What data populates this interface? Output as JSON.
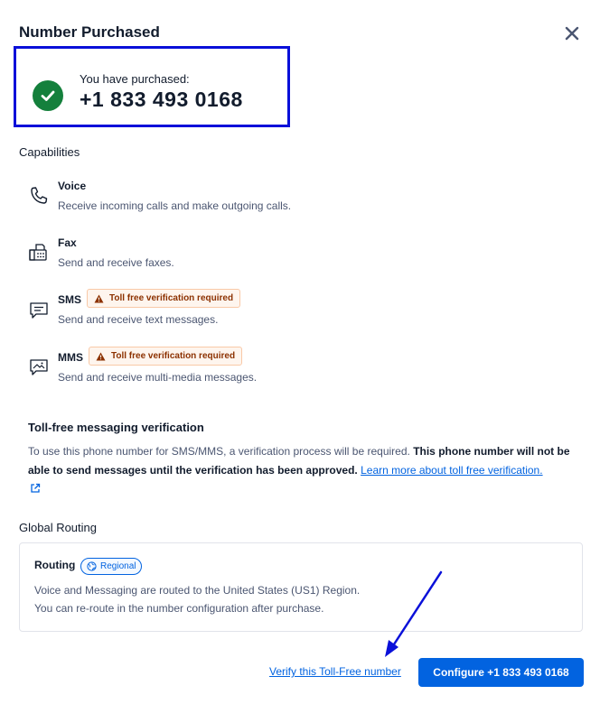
{
  "modal": {
    "title": "Number Purchased",
    "close_icon": "close-icon"
  },
  "purchase": {
    "label": "You have purchased:",
    "number": "+1 833 493 0168",
    "status_icon": "check-circle-icon",
    "status_color": "#14803c"
  },
  "capabilities": {
    "title": "Capabilities",
    "items": [
      {
        "name": "Voice",
        "description": "Receive incoming calls and make outgoing calls.",
        "icon": "phone-icon",
        "badge": ""
      },
      {
        "name": "Fax",
        "description": "Send and receive faxes.",
        "icon": "fax-icon",
        "badge": ""
      },
      {
        "name": "SMS",
        "description": "Send and receive text messages.",
        "icon": "sms-icon",
        "badge": "Toll free verification required"
      },
      {
        "name": "MMS",
        "description": "Send and receive multi-media messages.",
        "icon": "mms-icon",
        "badge": "Toll free verification required"
      }
    ]
  },
  "tollfree": {
    "title": "Toll-free messaging verification",
    "body_text": "To use this phone number for SMS/MMS, a verification process will be required. ",
    "body_bold": "This phone number will not be able to send messages until the verification has been approved.",
    "link_text": "Learn more about toll free verification.",
    "link_icon": "external-link-icon"
  },
  "routing": {
    "section_title": "Global Routing",
    "label": "Routing",
    "pill": "Regional",
    "pill_icon": "globe-icon",
    "line1": "Voice and Messaging are routed to the United States (US1) Region.",
    "line2": "You can re-route in the number configuration after purchase."
  },
  "footer": {
    "verify_link": "Verify this Toll-Free number",
    "configure_button": "Configure +1 833 493 0168"
  },
  "colors": {
    "primary": "#0263e0",
    "highlight_box": "#0a10d9",
    "warning_text": "#8c3100",
    "warning_bg": "#fef5ee"
  }
}
